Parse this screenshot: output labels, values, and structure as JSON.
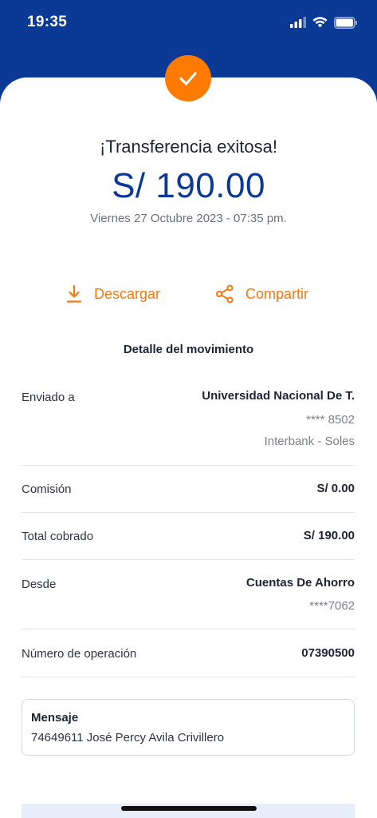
{
  "status_bar": {
    "time": "19:35"
  },
  "header": {
    "title": "¡Transferencia exitosa!",
    "amount": "S/ 190.00",
    "date": "Viernes 27 Octubre 2023 - 07:35 pm."
  },
  "actions": {
    "download_label": "Descargar",
    "share_label": "Compartir"
  },
  "detail": {
    "title": "Detalle del movimiento",
    "sent_to": {
      "label": "Enviado a",
      "name": "Universidad Nacional De T.",
      "account": "**** 8502",
      "bank": "Interbank - Soles"
    },
    "commission": {
      "label": "Comisión",
      "value": "S/ 0.00"
    },
    "total": {
      "label": "Total cobrado",
      "value": "S/ 190.00"
    },
    "from": {
      "label": "Desde",
      "account_type": "Cuentas De Ahorro",
      "account": "****7062"
    },
    "operation": {
      "label": "Número de operación",
      "value": "07390500"
    }
  },
  "message": {
    "label": "Mensaje",
    "text": "74649611 José Percy Avila Crivillero"
  },
  "colors": {
    "brand_blue": "#0a3a96",
    "accent_orange": "#ff7a00"
  }
}
